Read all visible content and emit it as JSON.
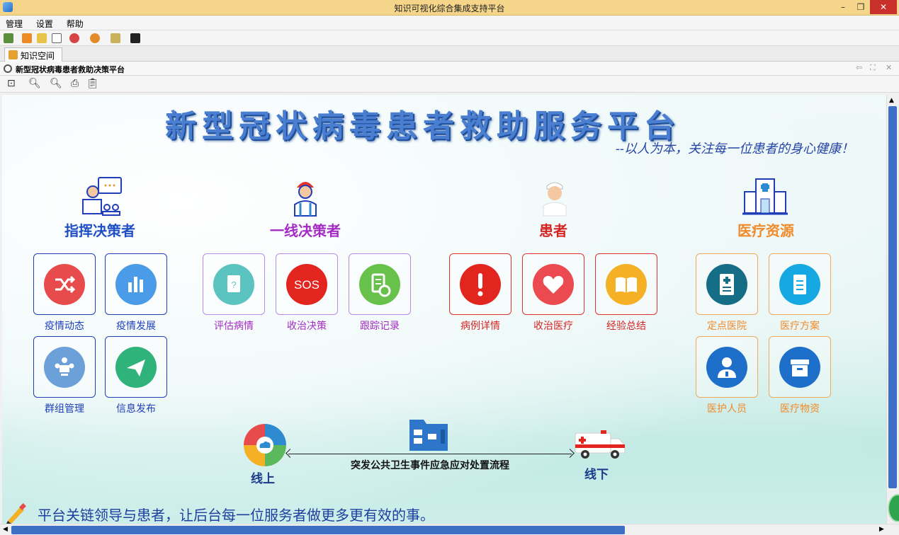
{
  "window": {
    "title": "知识可视化综合集成支持平台",
    "minimize": "–",
    "maximize": "❐",
    "close": "✕"
  },
  "menu": [
    "管理",
    "设置",
    "帮助"
  ],
  "tab": {
    "label": "知识空间"
  },
  "panel": {
    "title": "新型冠状病毒患者救助决策平台"
  },
  "content": {
    "title": "新型冠状病毒患者救助服务平台",
    "subtitle": "--以人为本，关注每一位患者的身心健康！",
    "categories": [
      {
        "label": "指挥决策者",
        "color": "#1f4fc4"
      },
      {
        "label": "一线决策者",
        "color": "#a32bc4"
      },
      {
        "label": "患者",
        "color": "#d42525"
      },
      {
        "label": "医疗资源",
        "color": "#f08a2a"
      }
    ],
    "tiles": {
      "commander": [
        "疫情动态",
        "疫情发展",
        "群组管理",
        "信息发布"
      ],
      "frontline": [
        "评估病情",
        "收治决策",
        "跟踪记录"
      ],
      "patient": [
        "病例详情",
        "收治医疗",
        "经验总结"
      ],
      "resources": [
        "定点医院",
        "医疗方案",
        "医护人员",
        "医疗物资"
      ]
    },
    "sos": "SOS",
    "flow": {
      "online": "线上",
      "offline": "线下",
      "label": "突发公共卫生事件应急应对处置流程"
    },
    "slogan": "平台关链领导与患者，让后台每一位服务者做更多更有效的事。"
  },
  "colors": {
    "commander_border": "#1f3fb8",
    "frontline_border": "#b98ae6",
    "patient_border": "#e03232",
    "resource_border": "#f3a95a",
    "scroll_thumb": "#3d6fc5"
  }
}
